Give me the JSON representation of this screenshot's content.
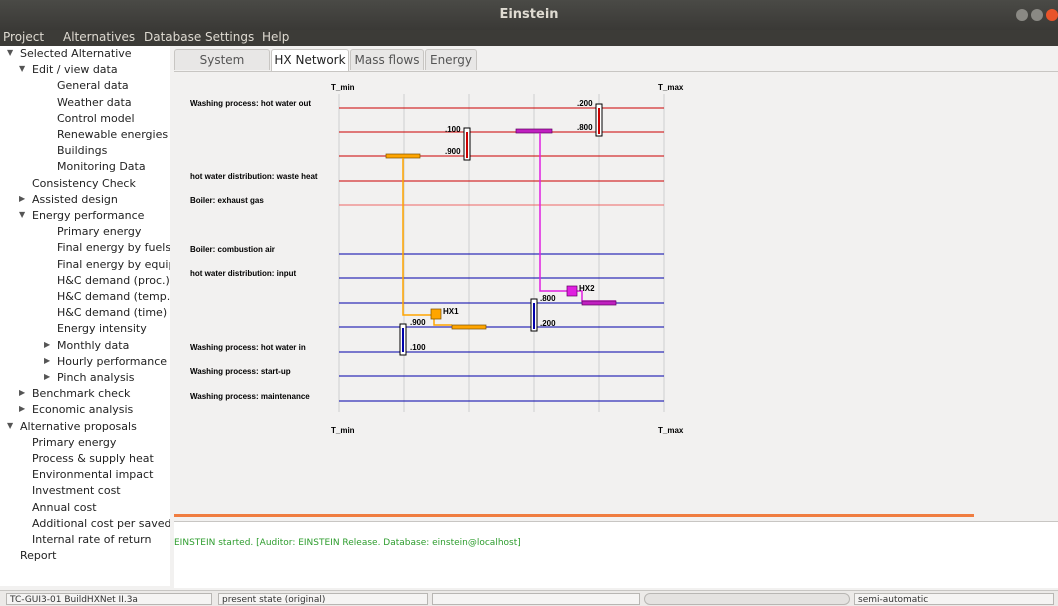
{
  "window": {
    "title": "Einstein"
  },
  "menu": [
    "Project",
    "Alternatives",
    "Database",
    "Settings",
    "Help"
  ],
  "tree": [
    {
      "label": "Selected Alternative",
      "level": 0,
      "arrow": "down"
    },
    {
      "label": "Edit / view data",
      "level": 1,
      "arrow": "down"
    },
    {
      "label": "General data",
      "level": 2
    },
    {
      "label": "Weather data",
      "level": 2
    },
    {
      "label": "Control model",
      "level": 2
    },
    {
      "label": "Renewable energies",
      "level": 2
    },
    {
      "label": "Buildings",
      "level": 2
    },
    {
      "label": "Monitoring Data",
      "level": 2
    },
    {
      "label": "Consistency Check",
      "level": 1
    },
    {
      "label": "Assisted design",
      "level": 1,
      "arrow": "right"
    },
    {
      "label": "Energy performance",
      "level": 1,
      "arrow": "down"
    },
    {
      "label": "Primary energy",
      "level": 2
    },
    {
      "label": "Final energy by fuels",
      "level": 2
    },
    {
      "label": "Final energy by equipm",
      "level": 2
    },
    {
      "label": "H&C demand (proc.)",
      "level": 2
    },
    {
      "label": "H&C demand (temp.)",
      "level": 2
    },
    {
      "label": "H&C demand (time)",
      "level": 2
    },
    {
      "label": "Energy intensity",
      "level": 2
    },
    {
      "label": "Monthly data",
      "level": 2,
      "arrow": "right"
    },
    {
      "label": "Hourly performance da",
      "level": 2,
      "arrow": "right"
    },
    {
      "label": "Pinch analysis",
      "level": 2,
      "arrow": "right"
    },
    {
      "label": "Benchmark check",
      "level": 1,
      "arrow": "right"
    },
    {
      "label": "Economic analysis",
      "level": 1,
      "arrow": "right"
    },
    {
      "label": "Alternative proposals",
      "level": 0,
      "arrow": "down"
    },
    {
      "label": "Primary energy",
      "level": 1
    },
    {
      "label": "Process & supply heat",
      "level": 1
    },
    {
      "label": "Environmental  impact",
      "level": 1
    },
    {
      "label": "Investment cost",
      "level": 1
    },
    {
      "label": "Annual cost",
      "level": 1
    },
    {
      "label": "Additional cost per saved",
      "level": 1
    },
    {
      "label": "Internal rate of return",
      "level": 1
    },
    {
      "label": "Report",
      "level": 0
    }
  ],
  "tabs": [
    "System scheme",
    "HX Network",
    "Mass flows",
    "Energy"
  ],
  "active_tab": 1,
  "diagram": {
    "t_min": "T_min",
    "t_max": "T_max",
    "hot_streams": [
      "Washing process: hot water out",
      "",
      "",
      "hot water distribution: waste heat",
      "Boiler: exhaust gas"
    ],
    "cold_streams": [
      "Boiler: combustion air",
      "hot water distribution: input",
      "",
      "",
      "Washing process: hot water in",
      "Washing process: start-up",
      "Washing process: maintenance"
    ],
    "hx": [
      {
        "name": "HX1",
        "color": "#ffa500",
        "hot_split": [
          ".100",
          ".900"
        ],
        "cold_split": [
          ".900",
          ".100"
        ]
      },
      {
        "name": "HX2",
        "color": "#e020e0",
        "hot_split": [
          ".200",
          ".800"
        ],
        "cold_split": [
          ".800",
          ".200"
        ]
      }
    ],
    "hot_color": "#cc0000",
    "cold_color": "#0000aa"
  },
  "log": {
    "message": "EINSTEIN started. [Auditor: EINSTEIN Release. Database: einstein@localhost]"
  },
  "status": [
    "TC-GUI3-01 BuildHXNet II.3a",
    "present state (original)",
    "",
    "",
    "semi-automatic"
  ]
}
